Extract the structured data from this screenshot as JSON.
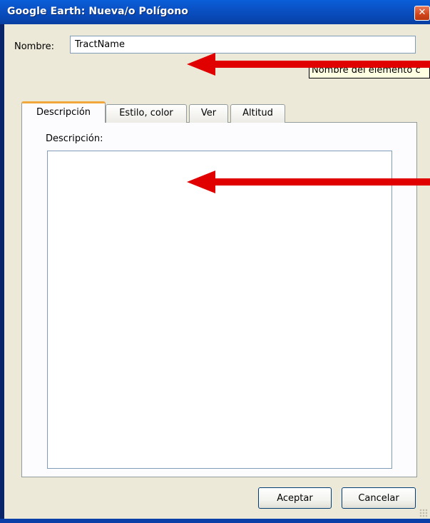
{
  "window": {
    "title": "Google Earth: Nueva/o Polígono",
    "close_symbol": "✕"
  },
  "form": {
    "name_label": "Nombre:",
    "name_value": "TractName",
    "tooltip": "Nombre del elemento c",
    "tabs": [
      {
        "label": "Descripción",
        "active": true
      },
      {
        "label": "Estilo, color",
        "active": false
      },
      {
        "label": "Ver",
        "active": false
      },
      {
        "label": "Altitud",
        "active": false
      }
    ],
    "description_label": "Descripción:",
    "description_value": ""
  },
  "buttons": {
    "ok_label": "Aceptar",
    "cancel_label": "Cancelar"
  },
  "annotations": {
    "arrow_color": "#e00000"
  },
  "colors": {
    "titlebar": "#0a52c7",
    "dialog_bg": "#ece9d8",
    "active_tab_accent": "#f2a73c"
  }
}
